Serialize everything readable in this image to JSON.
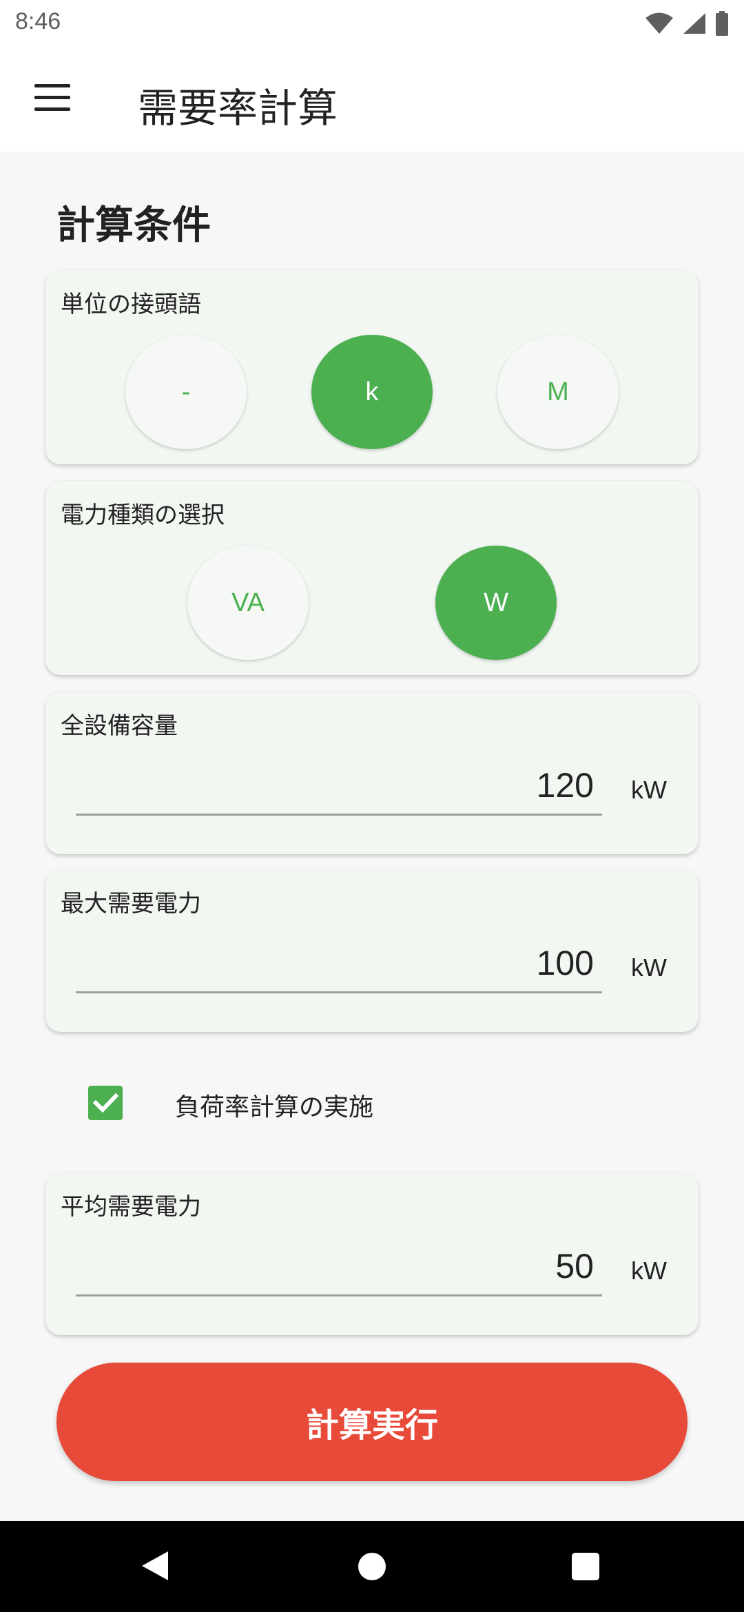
{
  "status_bar": {
    "time": "8:46",
    "icons": [
      "wifi-icon",
      "signal-icon",
      "battery-icon"
    ]
  },
  "app_bar": {
    "title": "需要率計算",
    "menu_icon": "menu-icon"
  },
  "form": {
    "section_title": "計算条件",
    "prefix": {
      "label": "単位の接頭語",
      "options": [
        "-",
        "k",
        "M"
      ],
      "selected": "k"
    },
    "power_type": {
      "label": "電力種類の選択",
      "options": [
        "VA",
        "W"
      ],
      "selected": "W"
    },
    "total_capacity": {
      "label": "全設備容量",
      "value": "120",
      "unit": "kW"
    },
    "max_demand": {
      "label": "最大需要電力",
      "value": "100",
      "unit": "kW"
    },
    "load_factor": {
      "label": "負荷率計算の実施",
      "checked": true
    },
    "avg_demand": {
      "label": "平均需要電力",
      "value": "50",
      "unit": "kW"
    },
    "execute_button": "計算実行"
  },
  "colors": {
    "accent": "#4caf50",
    "button": "#e84a3a",
    "card": "#f2f7f2"
  },
  "nav_bar": {
    "icons": [
      "back-icon",
      "home-icon",
      "recents-icon"
    ]
  }
}
